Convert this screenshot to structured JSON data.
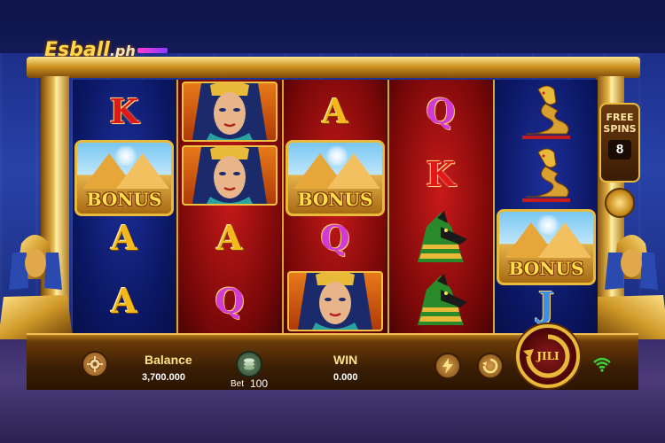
{
  "brand": {
    "logo_main": "Esball",
    "logo_suffix": ".ph"
  },
  "free_spins": {
    "label_line1": "FREE",
    "label_line2": "SPINS",
    "count": "8"
  },
  "reels": [
    {
      "color": "blue",
      "symbols": [
        "K",
        "BONUS",
        "A",
        "A"
      ]
    },
    {
      "color": "red",
      "symbols": [
        "CLEOPATRA",
        "CLEOPATRA",
        "A",
        "Q"
      ]
    },
    {
      "color": "red",
      "symbols": [
        "A",
        "BONUS",
        "Q",
        "CLEOPATRA"
      ]
    },
    {
      "color": "red",
      "symbols": [
        "Q",
        "K",
        "ANUBIS",
        "ANUBIS"
      ]
    },
    {
      "color": "blue",
      "symbols": [
        "COBRA",
        "COBRA",
        "BONUS",
        "J"
      ]
    }
  ],
  "symbol_text": {
    "k": "K",
    "a": "A",
    "q": "Q",
    "j": "J",
    "bonus": "BONUS"
  },
  "bottom": {
    "balance_label": "Balance",
    "balance_value": "3,700.000",
    "bet_label": "Bet",
    "bet_value": "100",
    "win_label": "WIN",
    "win_value": "0.000",
    "spin_logo": "JILI"
  },
  "icons": {
    "settings": "gear-icon",
    "bet": "coin-stack-icon",
    "turbo": "lightning-icon",
    "autoplay": "auto-spin-icon",
    "spin": "spin-arrow-icon",
    "network": "wifi-icon"
  },
  "colors": {
    "gold": "#e9b93a",
    "reel_blue": "#0a1660",
    "reel_red": "#7a0808",
    "wifi_green": "#3ad43a"
  }
}
